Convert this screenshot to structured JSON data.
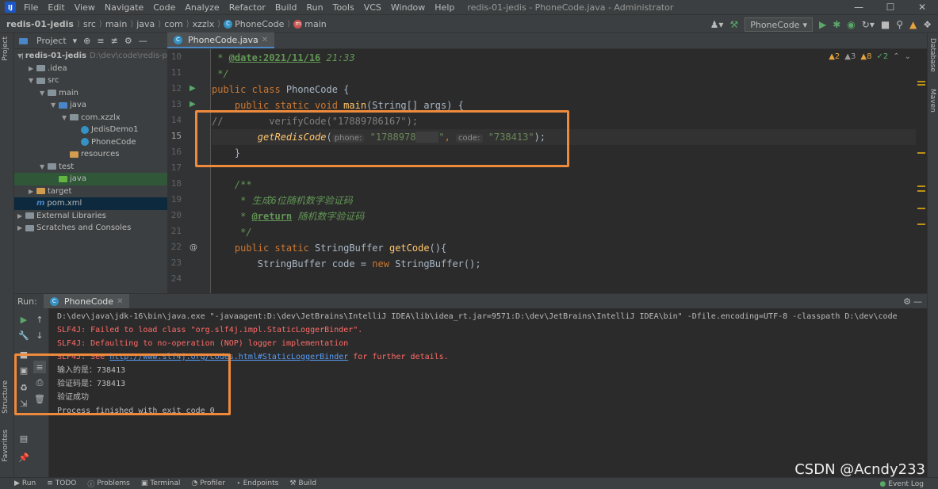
{
  "menubar": {
    "items": [
      "File",
      "Edit",
      "View",
      "Navigate",
      "Code",
      "Analyze",
      "Refactor",
      "Build",
      "Run",
      "Tools",
      "VCS",
      "Window",
      "Help"
    ],
    "title": "redis-01-jedis - PhoneCode.java - Administrator"
  },
  "breadcrumb": [
    "redis-01-jedis",
    "src",
    "main",
    "java",
    "com",
    "xzzlx",
    "PhoneCode",
    "main"
  ],
  "run_config": "PhoneCode",
  "project_panel": {
    "title": "Project",
    "tree": [
      {
        "label": "redis-01-jedis",
        "path": "D:\\dev\\code\\redis-p"
      },
      {
        "label": ".idea"
      },
      {
        "label": "src"
      },
      {
        "label": "main"
      },
      {
        "label": "java"
      },
      {
        "label": "com.xzzlx"
      },
      {
        "label": "JedisDemo1"
      },
      {
        "label": "PhoneCode"
      },
      {
        "label": "resources"
      },
      {
        "label": "test"
      },
      {
        "label": "java"
      },
      {
        "label": "target"
      },
      {
        "label": "pom.xml"
      },
      {
        "label": "External Libraries"
      },
      {
        "label": "Scratches and Consoles"
      }
    ]
  },
  "editor": {
    "tab": "PhoneCode.java",
    "inspections": {
      "warn1": "2",
      "weak": "3",
      "warn2": "8",
      "ok": "2"
    },
    "line_numbers": [
      "10",
      "11",
      "12",
      "13",
      "14",
      "15",
      "16",
      "17",
      "18",
      "19",
      "20",
      "21",
      "22",
      "23",
      "24"
    ],
    "code": {
      "l10a": " * ",
      "l10b": "@date:2021/11/16",
      "l10c": " 21:33",
      "l11": " */",
      "l12a": "public class ",
      "l12b": "PhoneCode",
      "l12c": " {",
      "l13a": "    public static void ",
      "l13b": "main",
      "l13c": "(String[] args) {",
      "l14a": "//        verifyCode(\"17889786167\");",
      "l15a": "        ",
      "l15b": "getRedisCode",
      "l15c": "(",
      "l15h1": "phone:",
      "l15s1": " \"1788978",
      "l15mask": "    ",
      "l15s1b": "\"",
      "l15d": ", ",
      "l15h2": "code:",
      "l15s2": " \"738413\"",
      "l15e": ");",
      "l16": "    }",
      "l18": "    /**",
      "l19": "     * 生成6位随机数字验证码",
      "l20a": "     * ",
      "l20b": "@return",
      "l20c": " 随机数字验证码",
      "l21": "     */",
      "l22a": "    public static ",
      "l22b": "StringBuffer ",
      "l22c": "getCode",
      "l22d": "(){",
      "l23a": "        StringBuffer code = ",
      "l23b": "new ",
      "l23c": "StringBuffer();"
    }
  },
  "run_panel": {
    "label": "Run:",
    "tab": "PhoneCode",
    "console": {
      "cmd": "D:\\dev\\java\\jdk-16\\bin\\java.exe \"-javaagent:D:\\dev\\JetBrains\\IntelliJ IDEA\\lib\\idea_rt.jar=9571:D:\\dev\\JetBrains\\IntelliJ IDEA\\bin\" -Dfile.encoding=UTF-8 -classpath D:\\dev\\code",
      "err1": "SLF4J: Failed to load class \"org.slf4j.impl.StaticLoggerBinder\".",
      "err2": "SLF4J: Defaulting to no-operation (NOP) logger implementation",
      "err3a": "SLF4J: See ",
      "err3link": "http://www.slf4j.org/codes.html#StaticLoggerBinder",
      "err3b": " for further details.",
      "out1": "输入的是：738413",
      "out2": "验证码是：738413",
      "out3": "验证成功",
      "out4": "Process finished with exit code 0"
    }
  },
  "side_labels": {
    "project": "Project",
    "structure": "Structure",
    "favorites": "Favorites",
    "database": "Database",
    "maven": "Maven"
  },
  "status_bar": [
    "Run",
    "TODO",
    "Problems",
    "Terminal",
    "Profiler",
    "Endpoints",
    "Build"
  ],
  "event_log": "Event Log",
  "watermark": "CSDN @Acndy233",
  "colors": {
    "accent": "#4a88c7",
    "highlight_box": "#ef8a3c",
    "error": "#ff6b68",
    "link": "#589df6"
  }
}
